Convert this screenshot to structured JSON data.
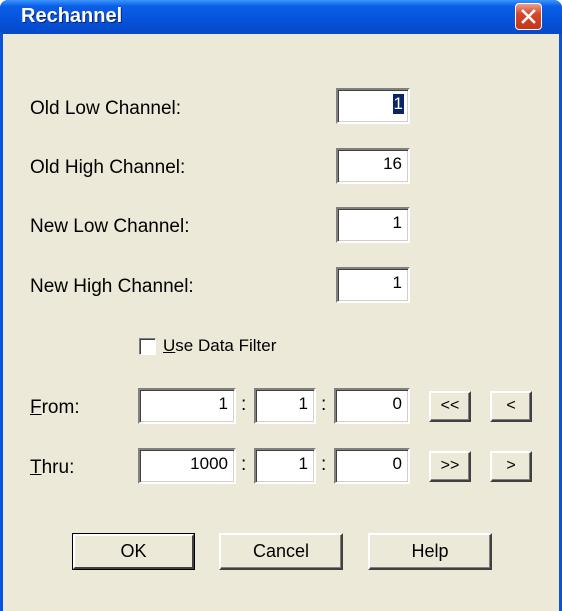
{
  "window": {
    "title": "Rechannel"
  },
  "fields": {
    "old_low": {
      "label": "Old Low Channel:",
      "value": "1"
    },
    "old_high": {
      "label": "Old High Channel:",
      "value": "16"
    },
    "new_low": {
      "label": "New Low Channel:",
      "value": "1"
    },
    "new_high": {
      "label": "New High Channel:",
      "value": "1"
    }
  },
  "filter": {
    "checkbox_label_mnemonic": "U",
    "checkbox_label_rest": "se Data Filter",
    "checked": false
  },
  "from": {
    "label_mnemonic": "F",
    "label_rest": "rom:",
    "values": [
      "1",
      "1",
      "0"
    ],
    "separator": ":",
    "buttons": [
      "<<",
      "<"
    ]
  },
  "thru": {
    "label_mnemonic": "T",
    "label_rest": "hru:",
    "values": [
      "1000",
      "1",
      "0"
    ],
    "separator": ":",
    "buttons": [
      ">>",
      ">"
    ]
  },
  "buttons": {
    "ok": "OK",
    "cancel": "Cancel",
    "help": "Help"
  }
}
